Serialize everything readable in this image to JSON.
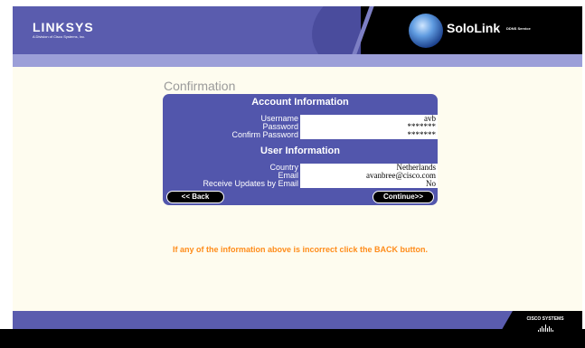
{
  "header": {
    "brand": "LINKSYS",
    "brand_sub": "A Division of Cisco Systems, Inc.",
    "product": "SoloLink",
    "product_sub": "DDNS Service"
  },
  "page_title": "Confirmation",
  "account": {
    "title": "Account Information",
    "rows": [
      {
        "label": "Username",
        "value": "avb"
      },
      {
        "label": "Password",
        "value": "*******"
      },
      {
        "label": "Confirm Password",
        "value": "*******"
      }
    ]
  },
  "user": {
    "title": "User Information",
    "rows": [
      {
        "label": "Country",
        "value": "Netherlands"
      },
      {
        "label": "Email",
        "value": "avanbree@cisco.com"
      },
      {
        "label": "Receive Updates by Email",
        "value": "No"
      }
    ]
  },
  "buttons": {
    "back": "<< Back",
    "continue": "Continue>>"
  },
  "note": "If any of the information above is incorrect click the BACK button.",
  "footer": {
    "brand": "CISCO SYSTEMS"
  },
  "colors": {
    "header": "#5a5cae",
    "panel": "#5256ac",
    "note": "#ff8c1a",
    "content_bg": "#fefcef"
  }
}
